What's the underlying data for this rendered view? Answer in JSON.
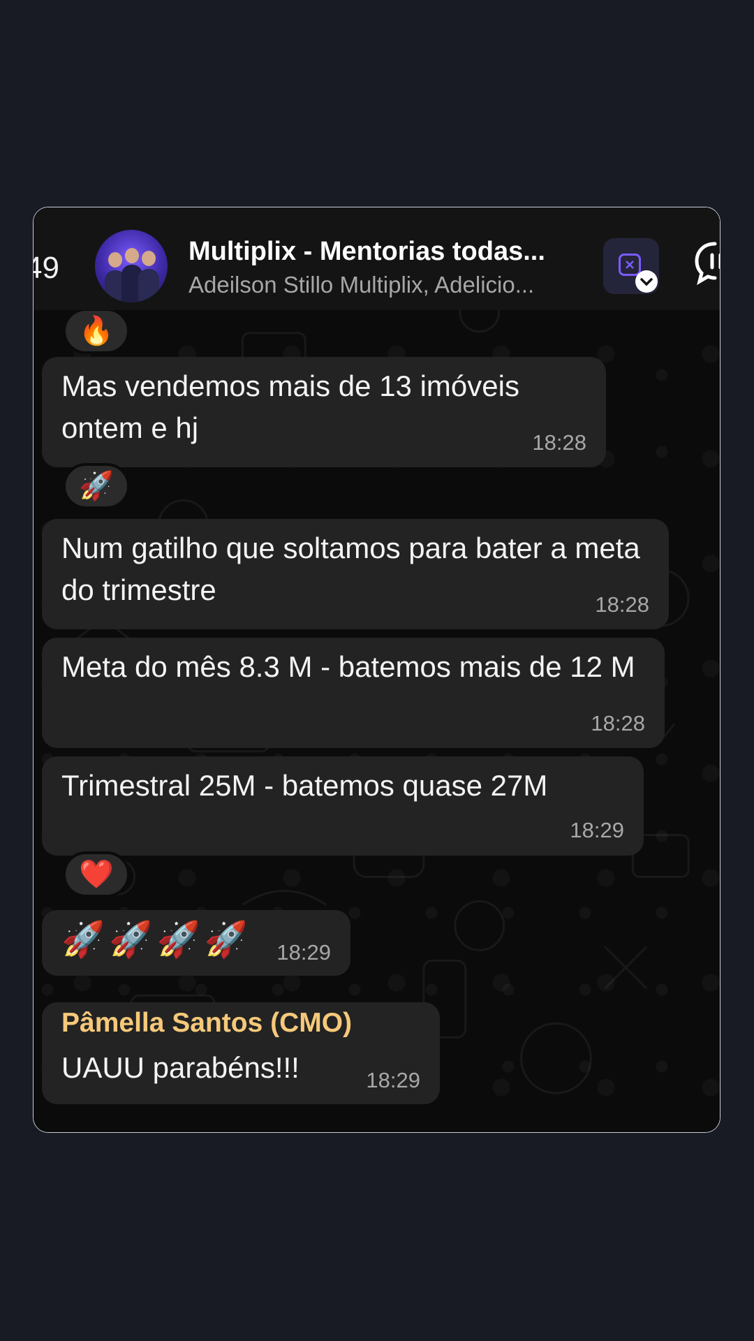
{
  "header": {
    "back_count": "49",
    "title": "Multiplix - Mentorias todas...",
    "subtitle": "Adeilson Stillo Multiplix, Adelicio..."
  },
  "messages": [
    {
      "text": "Mas vendemos mais de 13 imóveis ontem e hj",
      "time": "18:28"
    },
    {
      "text": "Num gatilho que soltamos para bater a meta do trimestre",
      "time": "18:28"
    },
    {
      "text": "Meta do mês 8.3 M - batemos mais de 12 M",
      "time": "18:28"
    },
    {
      "text": "Trimestral 25M - batemos quase 27M",
      "time": "18:29"
    },
    {
      "text": "🚀🚀🚀🚀",
      "time": "18:29"
    },
    {
      "sender": "Pâmella Santos (CMO)",
      "text": "UAUU parabéns!!!",
      "time": "18:29"
    }
  ],
  "reactions": [
    "🔥",
    "🚀",
    "❤️"
  ],
  "colors": {
    "page_bg": "#181b24",
    "bubble_bg": "#232323",
    "header_bg": "#141414",
    "sender_color": "#f6c97a",
    "accent": "#7b5cff"
  },
  "icons": [
    "extension-icon",
    "call-icon",
    "chevron-down-icon"
  ]
}
